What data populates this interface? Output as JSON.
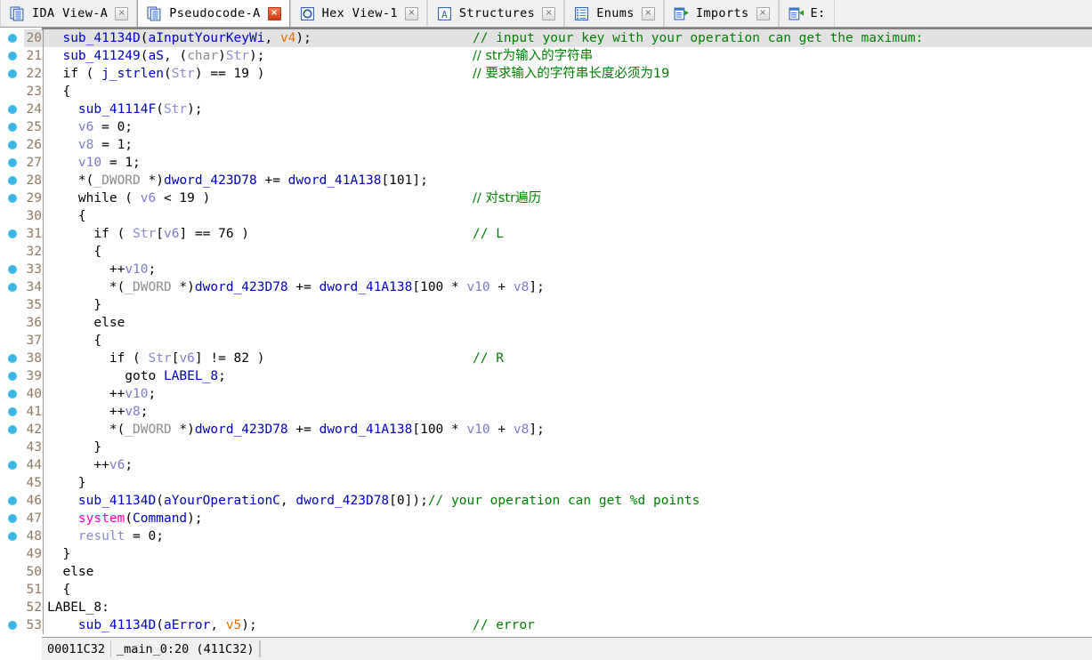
{
  "window": {
    "app": "IDA Pro",
    "active_view": "Pseudocode-A"
  },
  "tabs": [
    {
      "label": "IDA View-A",
      "icon": "document-pages-icon",
      "active": false,
      "close_label": "×",
      "close_style": "gray"
    },
    {
      "label": "Pseudocode-A",
      "icon": "document-pages-icon",
      "active": true,
      "close_label": "×",
      "close_style": "red"
    },
    {
      "label": "Hex View-1",
      "icon": "hex-circle-icon",
      "active": false,
      "close_label": "×",
      "close_style": "gray"
    },
    {
      "label": "Structures",
      "icon": "letter-a-box-icon",
      "active": false,
      "close_label": "×",
      "close_style": "gray"
    },
    {
      "label": "Enums",
      "icon": "list-lines-icon",
      "active": false,
      "close_label": "×",
      "close_style": "gray"
    },
    {
      "label": "Imports",
      "icon": "import-arrow-icon",
      "active": false,
      "close_label": "×",
      "close_style": "gray"
    },
    {
      "label": "E:",
      "icon": "export-arrow-icon",
      "active": false,
      "close_label": "",
      "close_style": "none"
    }
  ],
  "colors": {
    "comment_green": "#008000",
    "identifier_blue": "#0000c0",
    "local_orange": "#e07000",
    "variable_lavender": "#8a8ad8",
    "type_gray": "#8c8c8c",
    "library_magenta": "#ff00c0",
    "lineno_brown": "#8f7a63",
    "breakpoint_dot_cyan": "#3cb8e8",
    "highlight_row": "#e2e2e2"
  },
  "code": {
    "first_line": 20,
    "last_line": 53,
    "highlighted_line": 20,
    "lines": [
      {
        "n": 20,
        "dot": true,
        "hl": true,
        "tokens": [
          {
            "t": "  ",
            "c": "pl"
          },
          {
            "t": "sub_41134D",
            "c": "fn"
          },
          {
            "t": "(",
            "c": "pl"
          },
          {
            "t": "aInputYourKeyWi",
            "c": "k"
          },
          {
            "t": ", ",
            "c": "pl"
          },
          {
            "t": "v4",
            "c": "ov"
          },
          {
            "t": ");",
            "c": "pl"
          }
        ],
        "comment": "// input your key with your operation can get the maximum:"
      },
      {
        "n": 21,
        "dot": true,
        "hl": false,
        "tokens": [
          {
            "t": "  ",
            "c": "pl"
          },
          {
            "t": "sub_411249",
            "c": "fn"
          },
          {
            "t": "(",
            "c": "pl"
          },
          {
            "t": "aS",
            "c": "k"
          },
          {
            "t": ", (",
            "c": "pl"
          },
          {
            "t": "char",
            "c": "ty"
          },
          {
            "t": ")",
            "c": "pl"
          },
          {
            "t": "Str",
            "c": "var"
          },
          {
            "t": ");",
            "c": "pl"
          }
        ],
        "comment": "// str为输入的字符串"
      },
      {
        "n": 22,
        "dot": true,
        "hl": false,
        "tokens": [
          {
            "t": "  if ( ",
            "c": "pl"
          },
          {
            "t": "j_strlen",
            "c": "fn"
          },
          {
            "t": "(",
            "c": "pl"
          },
          {
            "t": "Str",
            "c": "var"
          },
          {
            "t": ") == 19 )",
            "c": "pl"
          }
        ],
        "comment": "// 要求输入的字符串长度必须为19"
      },
      {
        "n": 23,
        "dot": false,
        "hl": false,
        "tokens": [
          {
            "t": "  {",
            "c": "pl"
          }
        ],
        "comment": ""
      },
      {
        "n": 24,
        "dot": true,
        "hl": false,
        "tokens": [
          {
            "t": "    ",
            "c": "pl"
          },
          {
            "t": "sub_41114F",
            "c": "fn"
          },
          {
            "t": "(",
            "c": "pl"
          },
          {
            "t": "Str",
            "c": "var"
          },
          {
            "t": ");",
            "c": "pl"
          }
        ],
        "comment": ""
      },
      {
        "n": 25,
        "dot": true,
        "hl": false,
        "tokens": [
          {
            "t": "    ",
            "c": "pl"
          },
          {
            "t": "v6",
            "c": "lv"
          },
          {
            "t": " = 0;",
            "c": "pl"
          }
        ],
        "comment": ""
      },
      {
        "n": 26,
        "dot": true,
        "hl": false,
        "tokens": [
          {
            "t": "    ",
            "c": "pl"
          },
          {
            "t": "v8",
            "c": "lv"
          },
          {
            "t": " = 1;",
            "c": "pl"
          }
        ],
        "comment": ""
      },
      {
        "n": 27,
        "dot": true,
        "hl": false,
        "tokens": [
          {
            "t": "    ",
            "c": "pl"
          },
          {
            "t": "v10",
            "c": "lv"
          },
          {
            "t": " = 1;",
            "c": "pl"
          }
        ],
        "comment": ""
      },
      {
        "n": 28,
        "dot": true,
        "hl": false,
        "tokens": [
          {
            "t": "    *(",
            "c": "pl"
          },
          {
            "t": "_DWORD",
            "c": "ty"
          },
          {
            "t": " *)",
            "c": "pl"
          },
          {
            "t": "dword_423D78",
            "c": "k"
          },
          {
            "t": " += ",
            "c": "pl"
          },
          {
            "t": "dword_41A138",
            "c": "k"
          },
          {
            "t": "[101];",
            "c": "pl"
          }
        ],
        "comment": ""
      },
      {
        "n": 29,
        "dot": true,
        "hl": false,
        "tokens": [
          {
            "t": "    while ( ",
            "c": "pl"
          },
          {
            "t": "v6",
            "c": "lv"
          },
          {
            "t": " < 19 )",
            "c": "pl"
          }
        ],
        "comment": "// 对str遍历"
      },
      {
        "n": 30,
        "dot": false,
        "hl": false,
        "tokens": [
          {
            "t": "    {",
            "c": "pl"
          }
        ],
        "comment": ""
      },
      {
        "n": 31,
        "dot": true,
        "hl": false,
        "tokens": [
          {
            "t": "      if ( ",
            "c": "pl"
          },
          {
            "t": "Str",
            "c": "var"
          },
          {
            "t": "[",
            "c": "pl"
          },
          {
            "t": "v6",
            "c": "lv"
          },
          {
            "t": "] == 76 )",
            "c": "pl"
          }
        ],
        "comment": "// L"
      },
      {
        "n": 32,
        "dot": false,
        "hl": false,
        "tokens": [
          {
            "t": "      {",
            "c": "pl"
          }
        ],
        "comment": ""
      },
      {
        "n": 33,
        "dot": true,
        "hl": false,
        "tokens": [
          {
            "t": "        ++",
            "c": "pl"
          },
          {
            "t": "v10",
            "c": "lv"
          },
          {
            "t": ";",
            "c": "pl"
          }
        ],
        "comment": ""
      },
      {
        "n": 34,
        "dot": true,
        "hl": false,
        "tokens": [
          {
            "t": "        *(",
            "c": "pl"
          },
          {
            "t": "_DWORD",
            "c": "ty"
          },
          {
            "t": " *)",
            "c": "pl"
          },
          {
            "t": "dword_423D78",
            "c": "k"
          },
          {
            "t": " += ",
            "c": "pl"
          },
          {
            "t": "dword_41A138",
            "c": "k"
          },
          {
            "t": "[100 * ",
            "c": "pl"
          },
          {
            "t": "v10",
            "c": "lv"
          },
          {
            "t": " + ",
            "c": "pl"
          },
          {
            "t": "v8",
            "c": "lv"
          },
          {
            "t": "];",
            "c": "pl"
          }
        ],
        "comment": ""
      },
      {
        "n": 35,
        "dot": false,
        "hl": false,
        "tokens": [
          {
            "t": "      }",
            "c": "pl"
          }
        ],
        "comment": ""
      },
      {
        "n": 36,
        "dot": false,
        "hl": false,
        "tokens": [
          {
            "t": "      else",
            "c": "pl"
          }
        ],
        "comment": ""
      },
      {
        "n": 37,
        "dot": false,
        "hl": false,
        "tokens": [
          {
            "t": "      {",
            "c": "pl"
          }
        ],
        "comment": ""
      },
      {
        "n": 38,
        "dot": true,
        "hl": false,
        "tokens": [
          {
            "t": "        if ( ",
            "c": "pl"
          },
          {
            "t": "Str",
            "c": "var"
          },
          {
            "t": "[",
            "c": "pl"
          },
          {
            "t": "v6",
            "c": "lv"
          },
          {
            "t": "] != 82 )",
            "c": "pl"
          }
        ],
        "comment": "// R"
      },
      {
        "n": 39,
        "dot": true,
        "hl": false,
        "tokens": [
          {
            "t": "          goto ",
            "c": "pl"
          },
          {
            "t": "LABEL_8",
            "c": "k"
          },
          {
            "t": ";",
            "c": "pl"
          }
        ],
        "comment": ""
      },
      {
        "n": 40,
        "dot": true,
        "hl": false,
        "tokens": [
          {
            "t": "        ++",
            "c": "pl"
          },
          {
            "t": "v10",
            "c": "lv"
          },
          {
            "t": ";",
            "c": "pl"
          }
        ],
        "comment": ""
      },
      {
        "n": 41,
        "dot": true,
        "hl": false,
        "tokens": [
          {
            "t": "        ++",
            "c": "pl"
          },
          {
            "t": "v8",
            "c": "lv"
          },
          {
            "t": ";",
            "c": "pl"
          }
        ],
        "comment": ""
      },
      {
        "n": 42,
        "dot": true,
        "hl": false,
        "tokens": [
          {
            "t": "        *(",
            "c": "pl"
          },
          {
            "t": "_DWORD",
            "c": "ty"
          },
          {
            "t": " *)",
            "c": "pl"
          },
          {
            "t": "dword_423D78",
            "c": "k"
          },
          {
            "t": " += ",
            "c": "pl"
          },
          {
            "t": "dword_41A138",
            "c": "k"
          },
          {
            "t": "[100 * ",
            "c": "pl"
          },
          {
            "t": "v10",
            "c": "lv"
          },
          {
            "t": " + ",
            "c": "pl"
          },
          {
            "t": "v8",
            "c": "lv"
          },
          {
            "t": "];",
            "c": "pl"
          }
        ],
        "comment": ""
      },
      {
        "n": 43,
        "dot": false,
        "hl": false,
        "tokens": [
          {
            "t": "      }",
            "c": "pl"
          }
        ],
        "comment": ""
      },
      {
        "n": 44,
        "dot": true,
        "hl": false,
        "tokens": [
          {
            "t": "      ++",
            "c": "pl"
          },
          {
            "t": "v6",
            "c": "lv"
          },
          {
            "t": ";",
            "c": "pl"
          }
        ],
        "comment": ""
      },
      {
        "n": 45,
        "dot": false,
        "hl": false,
        "tokens": [
          {
            "t": "    }",
            "c": "pl"
          }
        ],
        "comment": ""
      },
      {
        "n": 46,
        "dot": true,
        "hl": false,
        "tokens": [
          {
            "t": "    ",
            "c": "pl"
          },
          {
            "t": "sub_41134D",
            "c": "fn"
          },
          {
            "t": "(",
            "c": "pl"
          },
          {
            "t": "aYourOperationC",
            "c": "k"
          },
          {
            "t": ", ",
            "c": "pl"
          },
          {
            "t": "dword_423D78",
            "c": "k"
          },
          {
            "t": "[0]);",
            "c": "pl"
          }
        ],
        "comment": "// your operation can get %d points",
        "inline_comment": true
      },
      {
        "n": 47,
        "dot": true,
        "hl": false,
        "tokens": [
          {
            "t": "    ",
            "c": "pl"
          },
          {
            "t": "system",
            "c": "lib"
          },
          {
            "t": "(",
            "c": "pl"
          },
          {
            "t": "Command",
            "c": "k"
          },
          {
            "t": ");",
            "c": "pl"
          }
        ],
        "comment": ""
      },
      {
        "n": 48,
        "dot": true,
        "hl": false,
        "tokens": [
          {
            "t": "    ",
            "c": "pl"
          },
          {
            "t": "result",
            "c": "var"
          },
          {
            "t": " = 0;",
            "c": "pl"
          }
        ],
        "comment": ""
      },
      {
        "n": 49,
        "dot": false,
        "hl": false,
        "tokens": [
          {
            "t": "  }",
            "c": "pl"
          }
        ],
        "comment": ""
      },
      {
        "n": 50,
        "dot": false,
        "hl": false,
        "tokens": [
          {
            "t": "  else",
            "c": "pl"
          }
        ],
        "comment": ""
      },
      {
        "n": 51,
        "dot": false,
        "hl": false,
        "tokens": [
          {
            "t": "  {",
            "c": "pl"
          }
        ],
        "comment": ""
      },
      {
        "n": 52,
        "dot": false,
        "hl": false,
        "tokens": [
          {
            "t": "LABEL_8:",
            "c": "pl"
          }
        ],
        "comment": "",
        "no_indent": true
      },
      {
        "n": 53,
        "dot": true,
        "hl": false,
        "tokens": [
          {
            "t": "    ",
            "c": "pl"
          },
          {
            "t": "sub_41134D",
            "c": "fn"
          },
          {
            "t": "(",
            "c": "pl"
          },
          {
            "t": "aError",
            "c": "k"
          },
          {
            "t": ", ",
            "c": "pl"
          },
          {
            "t": "v5",
            "c": "ov"
          },
          {
            "t": ");",
            "c": "pl"
          }
        ],
        "comment": "// error"
      }
    ]
  },
  "statusbar": {
    "file_offset": "00011C32",
    "location": "_main_0:20  (411C32)"
  }
}
